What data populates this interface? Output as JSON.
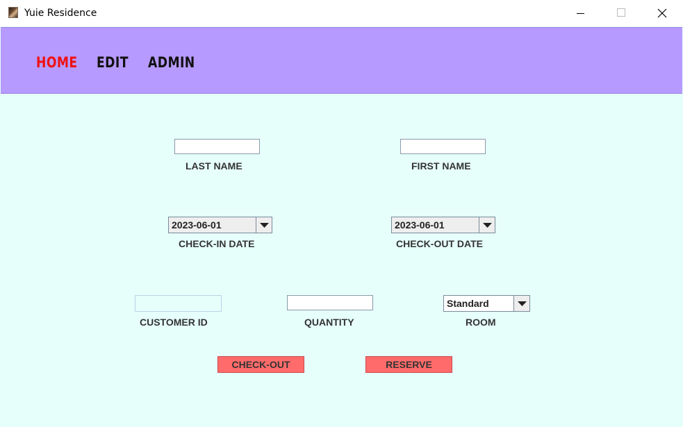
{
  "window": {
    "title": "Yuie Residence"
  },
  "nav": {
    "items": [
      {
        "label": "HOME",
        "active": true,
        "color": "#ee1111"
      },
      {
        "label": "EDIT",
        "active": false
      },
      {
        "label": "ADMIN",
        "active": false
      }
    ],
    "background": "#b79aff"
  },
  "form": {
    "background": "#e6fffb",
    "last_name": {
      "label": "LAST NAME",
      "value": ""
    },
    "first_name": {
      "label": "FIRST NAME",
      "value": ""
    },
    "check_in": {
      "label": "CHECK-IN DATE",
      "value": "2023-06-01"
    },
    "check_out": {
      "label": "CHECK-OUT DATE",
      "value": "2023-06-01"
    },
    "customer_id": {
      "label": "CUSTOMER ID",
      "value": ""
    },
    "quantity": {
      "label": "QUANTITY",
      "value": ""
    },
    "room": {
      "label": "ROOM",
      "value": "Standard"
    },
    "buttons": {
      "checkout": "CHECK-OUT",
      "reserve": "RESERVE",
      "color": "#ff6b6b"
    }
  },
  "icons": {
    "app": "app-icon",
    "minimize": "minimize-icon",
    "maximize": "maximize-icon",
    "close": "close-icon",
    "dropdown": "chevron-down-icon"
  }
}
